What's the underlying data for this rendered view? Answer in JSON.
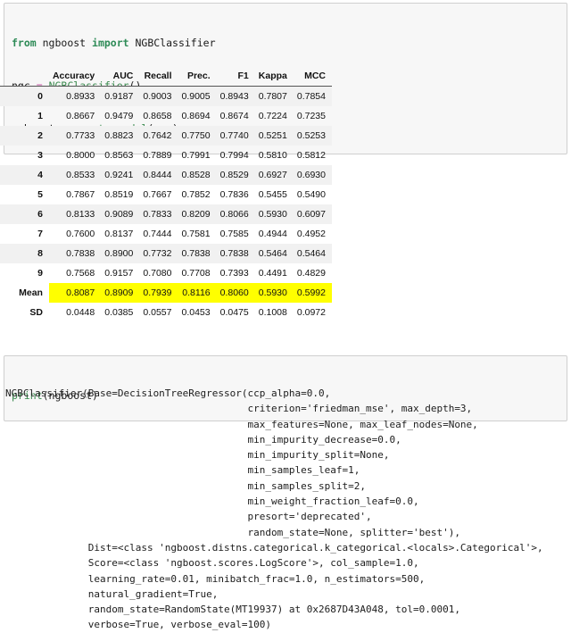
{
  "cells": {
    "input_1": {
      "lines": [
        [
          {
            "t": "from ",
            "c": "kw"
          },
          {
            "t": "ngboost ",
            "c": "plain"
          },
          {
            "t": "import ",
            "c": "kw"
          },
          {
            "t": "NGBClassifier",
            "c": "plain"
          }
        ],
        [
          {
            "t": "ngc ",
            "c": "plain"
          },
          {
            "t": "=",
            "c": "op"
          },
          {
            "t": " ",
            "c": "plain"
          },
          {
            "t": "NGBClassifier",
            "c": "fn"
          },
          {
            "t": "()",
            "c": "plain"
          }
        ],
        [
          {
            "t": "ngboost ",
            "c": "plain"
          },
          {
            "t": "=",
            "c": "op"
          },
          {
            "t": " ",
            "c": "plain"
          },
          {
            "t": "create_model",
            "c": "fn"
          },
          {
            "t": "(ngc)",
            "c": "plain"
          }
        ]
      ]
    },
    "input_2": {
      "lines": [
        [
          {
            "t": "print",
            "c": "fn"
          },
          {
            "t": "(ngboost)",
            "c": "plain"
          }
        ]
      ]
    }
  },
  "results_table": {
    "index_header": "",
    "columns": [
      "Accuracy",
      "AUC",
      "Recall",
      "Prec.",
      "F1",
      "Kappa",
      "MCC"
    ],
    "rows": [
      {
        "label": "0",
        "values": [
          "0.8933",
          "0.9187",
          "0.9003",
          "0.9005",
          "0.8943",
          "0.7807",
          "0.7854"
        ],
        "alt": true,
        "highlight": false
      },
      {
        "label": "1",
        "values": [
          "0.8667",
          "0.9479",
          "0.8658",
          "0.8694",
          "0.8674",
          "0.7224",
          "0.7235"
        ],
        "alt": false,
        "highlight": false
      },
      {
        "label": "2",
        "values": [
          "0.7733",
          "0.8823",
          "0.7642",
          "0.7750",
          "0.7740",
          "0.5251",
          "0.5253"
        ],
        "alt": true,
        "highlight": false
      },
      {
        "label": "3",
        "values": [
          "0.8000",
          "0.8563",
          "0.7889",
          "0.7991",
          "0.7994",
          "0.5810",
          "0.5812"
        ],
        "alt": false,
        "highlight": false
      },
      {
        "label": "4",
        "values": [
          "0.8533",
          "0.9241",
          "0.8444",
          "0.8528",
          "0.8529",
          "0.6927",
          "0.6930"
        ],
        "alt": true,
        "highlight": false
      },
      {
        "label": "5",
        "values": [
          "0.7867",
          "0.8519",
          "0.7667",
          "0.7852",
          "0.7836",
          "0.5455",
          "0.5490"
        ],
        "alt": false,
        "highlight": false
      },
      {
        "label": "6",
        "values": [
          "0.8133",
          "0.9089",
          "0.7833",
          "0.8209",
          "0.8066",
          "0.5930",
          "0.6097"
        ],
        "alt": true,
        "highlight": false
      },
      {
        "label": "7",
        "values": [
          "0.7600",
          "0.8137",
          "0.7444",
          "0.7581",
          "0.7585",
          "0.4944",
          "0.4952"
        ],
        "alt": false,
        "highlight": false
      },
      {
        "label": "8",
        "values": [
          "0.7838",
          "0.8900",
          "0.7732",
          "0.7838",
          "0.7838",
          "0.5464",
          "0.5464"
        ],
        "alt": true,
        "highlight": false
      },
      {
        "label": "9",
        "values": [
          "0.7568",
          "0.9157",
          "0.7080",
          "0.7708",
          "0.7393",
          "0.4491",
          "0.4829"
        ],
        "alt": false,
        "highlight": false
      },
      {
        "label": "Mean",
        "values": [
          "0.8087",
          "0.8909",
          "0.7939",
          "0.8116",
          "0.8060",
          "0.5930",
          "0.5992"
        ],
        "alt": false,
        "highlight": true
      },
      {
        "label": "SD",
        "values": [
          "0.0448",
          "0.0385",
          "0.0557",
          "0.0453",
          "0.0475",
          "0.1008",
          "0.0972"
        ],
        "alt": false,
        "highlight": false
      }
    ],
    "highlight_color": "#ffff00",
    "stripe_color": "#f1f1f1"
  },
  "stdout": {
    "text": "NGBClassifier(Base=DecisionTreeRegressor(ccp_alpha=0.0,\n                                         criterion='friedman_mse', max_depth=3,\n                                         max_features=None, max_leaf_nodes=None,\n                                         min_impurity_decrease=0.0,\n                                         min_impurity_split=None,\n                                         min_samples_leaf=1,\n                                         min_samples_split=2,\n                                         min_weight_fraction_leaf=0.0,\n                                         presort='deprecated',\n                                         random_state=None, splitter='best'),\n              Dist=<class 'ngboost.distns.categorical.k_categorical.<locals>.Categorical'>,\n              Score=<class 'ngboost.scores.LogScore'>, col_sample=1.0,\n              learning_rate=0.01, minibatch_frac=1.0, n_estimators=500,\n              natural_gradient=True,\n              random_state=RandomState(MT19937) at 0x2687D43A048, tol=0.0001,\n              verbose=True, verbose_eval=100)"
  }
}
